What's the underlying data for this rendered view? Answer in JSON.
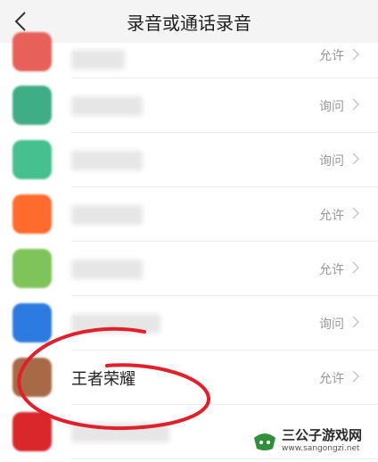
{
  "header": {
    "title": "录音或通话录音",
    "back_icon": "chevron-left-icon"
  },
  "apps": [
    {
      "name": "",
      "permission": "允许",
      "icon_color": "#e8605a"
    },
    {
      "name": "",
      "permission": "询问",
      "icon_color": "#3fae86"
    },
    {
      "name": "",
      "permission": "询问",
      "icon_color": "#45c08e"
    },
    {
      "name": "",
      "permission": "允许",
      "icon_color": "#ff6a2d"
    },
    {
      "name": "",
      "permission": "允许",
      "icon_color": "#7fc45a"
    },
    {
      "name": "",
      "permission": "询问",
      "icon_color": "#2d7be0"
    },
    {
      "name": "王者荣耀",
      "permission": "允许",
      "icon_color": "#a86a46"
    },
    {
      "name": "",
      "permission": "",
      "icon_color": "#d9272b"
    }
  ],
  "annotation": {
    "color": "#e0202a"
  },
  "watermark": {
    "title": "三公子游戏网",
    "url": "www.sangongzi.net",
    "logo_icon": "game-controller-icon"
  }
}
